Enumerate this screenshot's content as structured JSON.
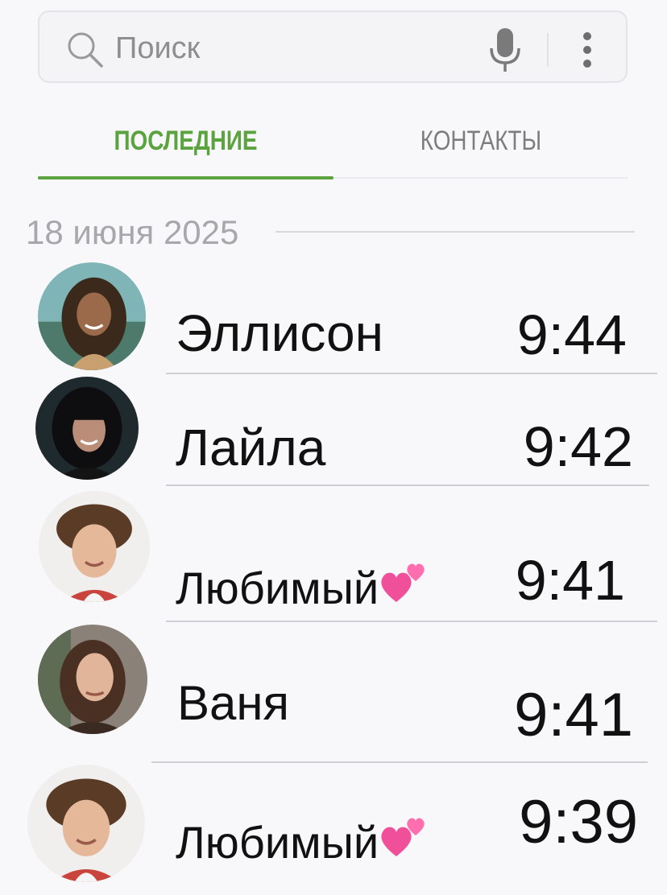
{
  "search": {
    "placeholder": "Поиск"
  },
  "tabs": [
    {
      "label": "ПОСЛЕДНИЕ",
      "active": true
    },
    {
      "label": "КОНТАКТЫ",
      "active": false
    }
  ],
  "colors": {
    "accent": "#5aa33f",
    "heart": "#f0509a"
  },
  "icons": {
    "search": "search-icon",
    "mic": "microphone-icon",
    "more": "more-vertical-icon",
    "heart": "two-hearts-icon"
  },
  "recents": {
    "date": "18 июня 2025",
    "calls": [
      {
        "name": "Эллисон",
        "time": "9:44",
        "heart": false
      },
      {
        "name": "Лайла",
        "time": "9:42",
        "heart": false
      },
      {
        "name": "Любимый",
        "time": "9:41",
        "heart": true
      },
      {
        "name": "Ваня",
        "time": "9:41",
        "heart": false
      },
      {
        "name": "Любимый",
        "time": "9:39",
        "heart": true
      }
    ]
  }
}
